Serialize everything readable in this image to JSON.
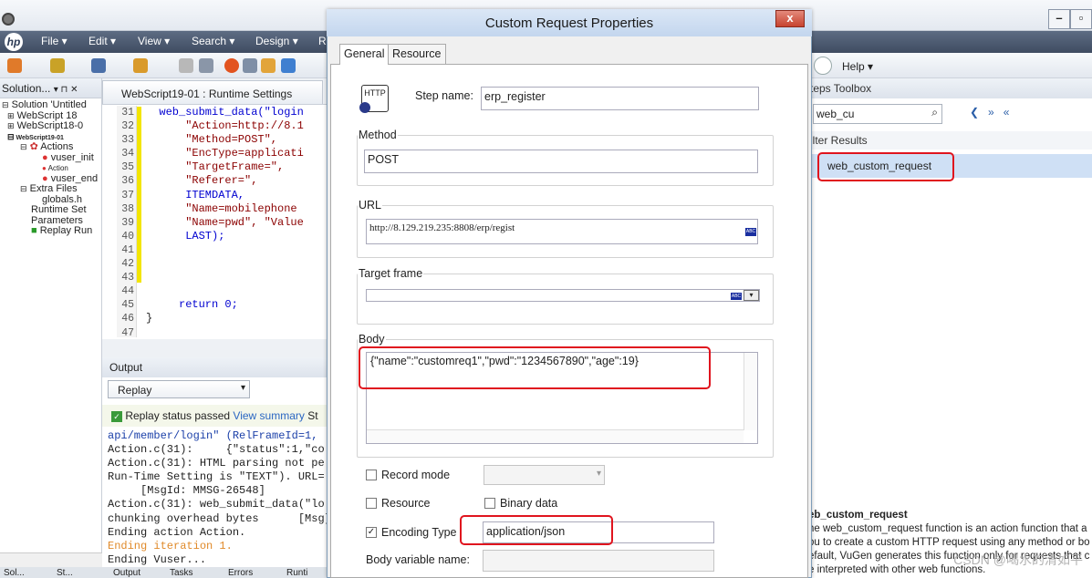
{
  "menu": {
    "items": [
      "File",
      "Edit",
      "View",
      "Search",
      "Design",
      "R"
    ],
    "help": "Help"
  },
  "solution": {
    "header": "Solution...",
    "tree": [
      "Solution 'Untitled",
      "WebScript 18",
      "WebScript18-0",
      "WebScript19-01",
      "Actions",
      "vuser_init",
      "Action",
      "vuser_end",
      "Extra Files",
      "globals.h",
      "Runtime Set",
      "Parameters",
      "Replay Run"
    ]
  },
  "editor": {
    "tab": "WebScript19-01 : Runtime Settings",
    "line_numbers": [
      "31",
      "32",
      "33",
      "34",
      "35",
      "36",
      "37",
      "38",
      "39",
      "40",
      "41",
      "42",
      "43",
      "44",
      "45",
      "46",
      "47"
    ],
    "code": [
      "web_submit_data(\"login",
      "  \"Action=http://8.1",
      "  \"Method=POST\",",
      "  \"EncType=applicati",
      "  \"TargetFrame=\",",
      "  \"Referer=\",",
      "  ITEMDATA,",
      "  \"Name=mobilephone",
      "  \"Name=pwd\", \"Value",
      "  LAST);",
      "",
      "",
      "",
      "",
      "return 0;",
      "}",
      ""
    ]
  },
  "output": {
    "header": "Output",
    "select": "Replay",
    "status": "Replay status passed",
    "summary_link": "View summary",
    "status_tail": "St",
    "lines": [
      "api/member/login\" (RelFrameId=1,",
      "Action.c(31):     {\"status\":1,\"co",
      "Action.c(31): HTML parsing not pe",
      "Run-Time Setting is \"TEXT\"). URL=",
      "     [MsgId: MMSG-26548]",
      "Action.c(31): web_submit_data(\"lo",
      "chunking overhead bytes      [Msg]",
      "Ending action Action.",
      "Ending iteration 1.",
      "Ending Vuser..."
    ]
  },
  "dialog": {
    "title": "Custom Request Properties",
    "close": "x",
    "tabs": [
      "General",
      "Resource"
    ],
    "http_icon": "HTTP",
    "step_name_label": "Step name:",
    "step_name": "erp_register",
    "method_label": "Method",
    "method": "POST",
    "url_label": "URL",
    "url": "http://8.129.219.235:8808/erp/regist",
    "abc": "ABC",
    "target_label": "Target frame",
    "target": "",
    "body_label": "Body",
    "body": "{\"name\":\"customreq1\",\"pwd\":\"1234567890\",\"age\":19}",
    "record_mode": "Record mode",
    "resource": "Resource",
    "binary": "Binary data",
    "enc_label": "Encoding Type",
    "enc": "application/json",
    "body_var": "Body variable name:"
  },
  "toolbox": {
    "header": "teps Toolbox",
    "search": "web_cu",
    "filter": "ilter Results",
    "result": "web_custom_request",
    "desc": [
      "eb_custom_request",
      "he web_custom_request function is an action function that a",
      "ou to create a custom HTTP request using any method or bo",
      "efault, VuGen generates this function only for requests that c",
      "e interpreted with other web functions."
    ]
  },
  "bottom_tabs": [
    "Sol...",
    "St...",
    "Output",
    "Tasks",
    "Errors",
    "Runti"
  ],
  "watermark": "CSDN @喝水的清如平"
}
